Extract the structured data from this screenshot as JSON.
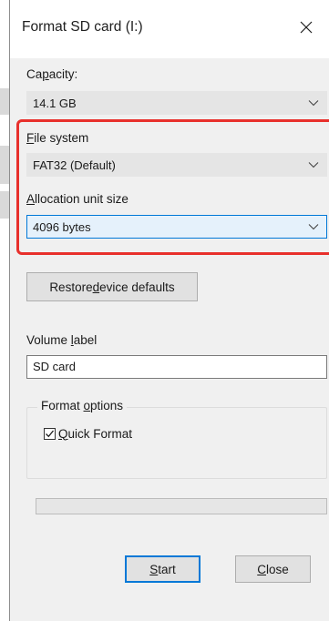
{
  "window": {
    "title": "Format SD card (I:)"
  },
  "capacity": {
    "label_pre": "Ca",
    "label_key": "p",
    "label_post": "acity:",
    "value": "14.1 GB"
  },
  "file_system": {
    "label_key": "F",
    "label_post": "ile system",
    "value": "FAT32 (Default)"
  },
  "allocation": {
    "label_key": "A",
    "label_post": "llocation unit size",
    "value": "4096 bytes"
  },
  "restore_button": {
    "label_pre": "Restore ",
    "label_key": "d",
    "label_post": "evice defaults"
  },
  "volume_label": {
    "label_pre": "Volume ",
    "label_key": "l",
    "label_post": "abel",
    "value": "SD card"
  },
  "format_options": {
    "legend_pre": "Format ",
    "legend_key": "o",
    "legend_post": "ptions",
    "quick_format": {
      "label_key": "Q",
      "label_post": "uick Format",
      "checked": true
    }
  },
  "progress": {
    "value": 0
  },
  "buttons": {
    "start": {
      "label_key": "S",
      "label_post": "tart"
    },
    "close": {
      "label_key": "C",
      "label_post": "lose"
    }
  },
  "colors": {
    "annotation_highlight": "#e8302c",
    "focus_accent": "#0078d7"
  }
}
